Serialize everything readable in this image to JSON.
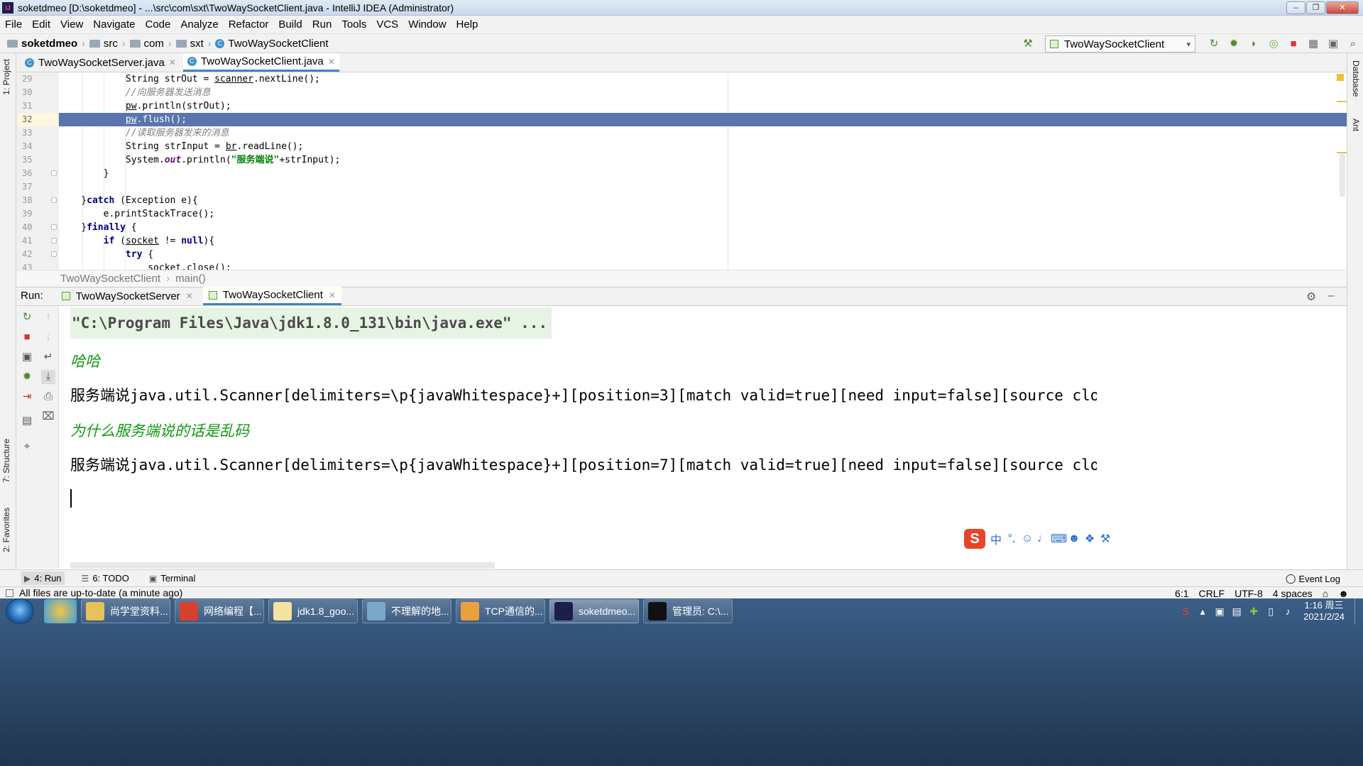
{
  "window": {
    "title": "soketdmeo [D:\\soketdmeo] - ...\\src\\com\\sxt\\TwoWaySocketClient.java - IntelliJ IDEA (Administrator)",
    "app_icon": "IJ"
  },
  "menu": [
    "File",
    "Edit",
    "View",
    "Navigate",
    "Code",
    "Analyze",
    "Refactor",
    "Build",
    "Run",
    "Tools",
    "VCS",
    "Window",
    "Help"
  ],
  "nav": {
    "project": "soketdmeo",
    "crumbs": [
      "src",
      "com",
      "sxt"
    ],
    "file": "TwoWaySocketClient",
    "run_config": "TwoWaySocketClient"
  },
  "editor_tabs": [
    {
      "label": "TwoWaySocketServer.java",
      "active": false
    },
    {
      "label": "TwoWaySocketClient.java",
      "active": true
    }
  ],
  "code_lines": [
    {
      "n": "29",
      "text": "            String strOut = scanner.nextLine();"
    },
    {
      "n": "30",
      "text": "            //向服务器发送消息"
    },
    {
      "n": "31",
      "text": "            pw.println(strOut);"
    },
    {
      "n": "32",
      "text": "            pw.flush();"
    },
    {
      "n": "33",
      "text": "            //读取服务器发来的消息"
    },
    {
      "n": "34",
      "text": "            String strInput = br.readLine();"
    },
    {
      "n": "35",
      "text": "            System.out.println(\"服务端说\"+strInput);"
    },
    {
      "n": "36",
      "text": "        }"
    },
    {
      "n": "37",
      "text": ""
    },
    {
      "n": "38",
      "text": "    }catch (Exception e){"
    },
    {
      "n": "39",
      "text": "        e.printStackTrace();"
    },
    {
      "n": "40",
      "text": "    }finally {"
    },
    {
      "n": "41",
      "text": "        if (socket != null){"
    },
    {
      "n": "42",
      "text": "            try {"
    },
    {
      "n": "43",
      "text": "                socket.close();"
    }
  ],
  "editor_crumb": {
    "class_name": "TwoWaySocketClient",
    "method": "main()"
  },
  "side_tabs": {
    "left": [
      "1: Project",
      "7: Structure",
      "2: Favorites"
    ],
    "right": [
      "Database",
      "Ant"
    ]
  },
  "run_panel": {
    "label": "Run:",
    "tabs": [
      {
        "label": "TwoWaySocketServer",
        "active": false
      },
      {
        "label": "TwoWaySocketClient",
        "active": true
      }
    ]
  },
  "console": {
    "cmd": "\"C:\\Program Files\\Java\\jdk1.8.0_131\\bin\\java.exe\" ...",
    "line1": "哈哈",
    "line2": "服务端说java.util.Scanner[delimiters=\\p{javaWhitespace}+][position=3][match valid=true][need input=false][source closed=false][",
    "line3": "为什么服务端说的话是乱码",
    "line4": "服务端说java.util.Scanner[delimiters=\\p{javaWhitespace}+][position=7][match valid=true][need input=false][source closed=false]["
  },
  "ime": {
    "logo": "S",
    "mode": "中"
  },
  "bottom_tabs": [
    {
      "label": "4: Run",
      "icon": "play-icon",
      "active": true
    },
    {
      "label": "6: TODO",
      "icon": "list-icon",
      "active": false
    },
    {
      "label": "Terminal",
      "icon": "terminal-icon",
      "active": false
    }
  ],
  "event_log": "Event Log",
  "status": {
    "message": "All files are up-to-date (a minute ago)",
    "position": "6:1",
    "line_sep": "CRLF",
    "encoding": "UTF-8",
    "indent": "4 spaces"
  },
  "taskbar": {
    "tasks": [
      {
        "label": "尚学堂资料...",
        "color": "#e8c15a"
      },
      {
        "label": "网络编程【...",
        "color": "#d8402f"
      },
      {
        "label": "jdk1.8_goo...",
        "color": "#f2e3a0"
      },
      {
        "label": "不理解的地...",
        "color": "#7aa8c8"
      },
      {
        "label": "TCP通信的...",
        "color": "#e9a23b"
      },
      {
        "label": "soketdmeo...",
        "color": "#1e1e4a",
        "active": true
      },
      {
        "label": "管理员: C:\\...",
        "color": "#111111"
      }
    ],
    "clock_time": "1:16 周三",
    "clock_date": "2021/2/24"
  }
}
